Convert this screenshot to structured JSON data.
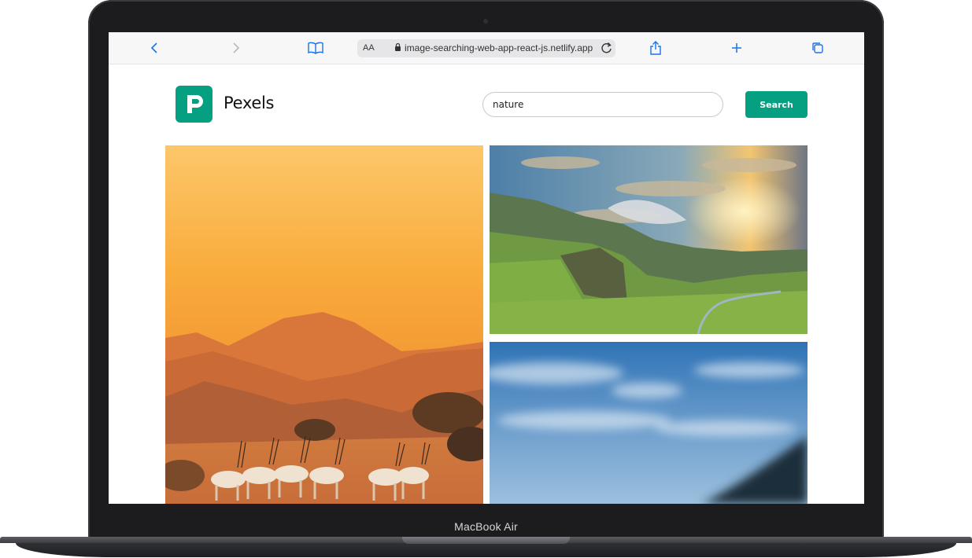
{
  "device": {
    "label": "MacBook Air"
  },
  "browser": {
    "text_size_label": "AA",
    "url": "image-searching-web-app-react-js.netlify.app"
  },
  "app": {
    "brand": "Pexels",
    "search": {
      "value": "nature",
      "placeholder": ""
    },
    "search_button_label": "Search",
    "accent_color": "#05a081"
  },
  "photos": [
    {
      "subject": "desert-mountains-oryx"
    },
    {
      "subject": "green-valley-sunset-clouds"
    },
    {
      "subject": "blurred-blue-sky"
    }
  ]
}
